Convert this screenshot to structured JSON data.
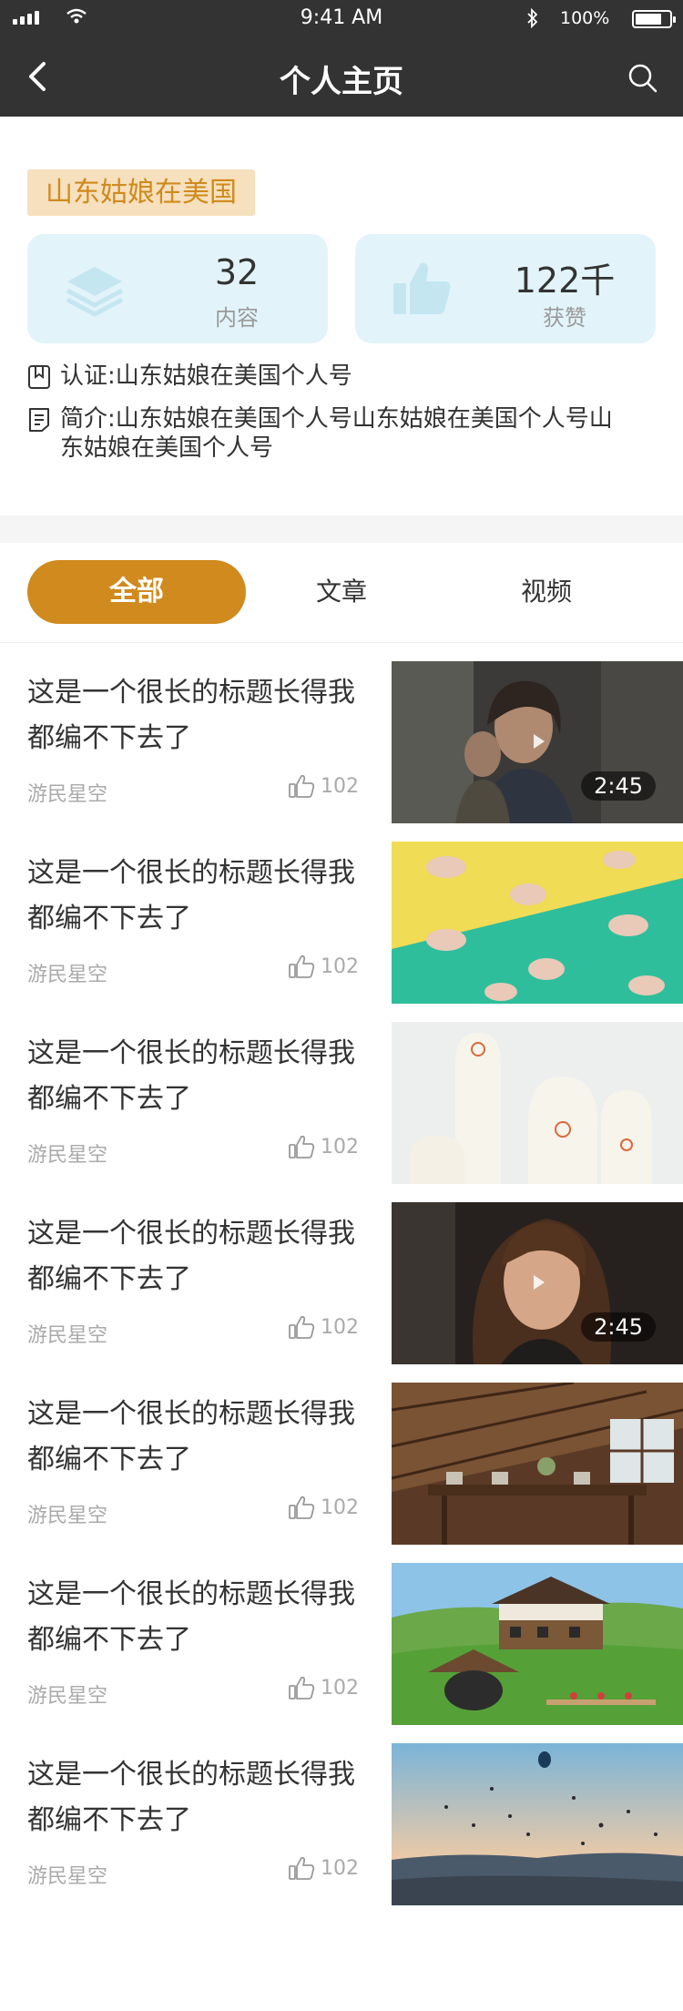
{
  "status_bar": {
    "time": "9:41 AM",
    "battery_pct": "100%"
  },
  "nav": {
    "title": "个人主页",
    "back_icon": "chevron-left-icon",
    "search_icon": "search-icon"
  },
  "profile": {
    "name": "山东姑娘在美国",
    "stats": [
      {
        "value": "32",
        "label": "内容",
        "icon": "layers-icon"
      },
      {
        "value": "122千",
        "label": "获赞",
        "icon": "thumbs-up-icon"
      }
    ],
    "certification": "认证:山东姑娘在美国个人号",
    "bio": "简介:山东姑娘在美国个人号山东姑娘在美国个人号山东姑娘在美国个人号"
  },
  "tabs": [
    {
      "label": "全部",
      "active": true
    },
    {
      "label": "文章",
      "active": false
    },
    {
      "label": "视频",
      "active": false
    }
  ],
  "colors": {
    "accent": "#d08a1d",
    "card_bg": "#e2f4fa",
    "name_tag_bg": "#f6e0bd",
    "header_bg": "#333333"
  },
  "feed": [
    {
      "title": "这是一个很长的标题长得我都编不下去了",
      "author": "游民星空",
      "likes": "102",
      "duration": "2:45",
      "thumb": "tv-drama-still"
    },
    {
      "title": "这是一个很长的标题长得我都编不下去了",
      "author": "游民星空",
      "likes": "102",
      "duration": "",
      "thumb": "animal-crackers"
    },
    {
      "title": "这是一个很长的标题长得我都编不下去了",
      "author": "游民星空",
      "likes": "102",
      "duration": "",
      "thumb": "white-bottles"
    },
    {
      "title": "这是一个很长的标题长得我都编不下去了",
      "author": "游民星空",
      "likes": "102",
      "duration": "2:45",
      "thumb": "woman-movie-still"
    },
    {
      "title": "这是一个很长的标题长得我都编不下去了",
      "author": "游民星空",
      "likes": "102",
      "duration": "",
      "thumb": "wooden-dining-room"
    },
    {
      "title": "这是一个很长的标题长得我都编不下去了",
      "author": "游民星空",
      "likes": "102",
      "duration": "",
      "thumb": "alpine-chalet"
    },
    {
      "title": "这是一个很长的标题长得我都编不下去了",
      "author": "游民星空",
      "likes": "102",
      "duration": "",
      "thumb": "hot-air-balloons"
    }
  ]
}
